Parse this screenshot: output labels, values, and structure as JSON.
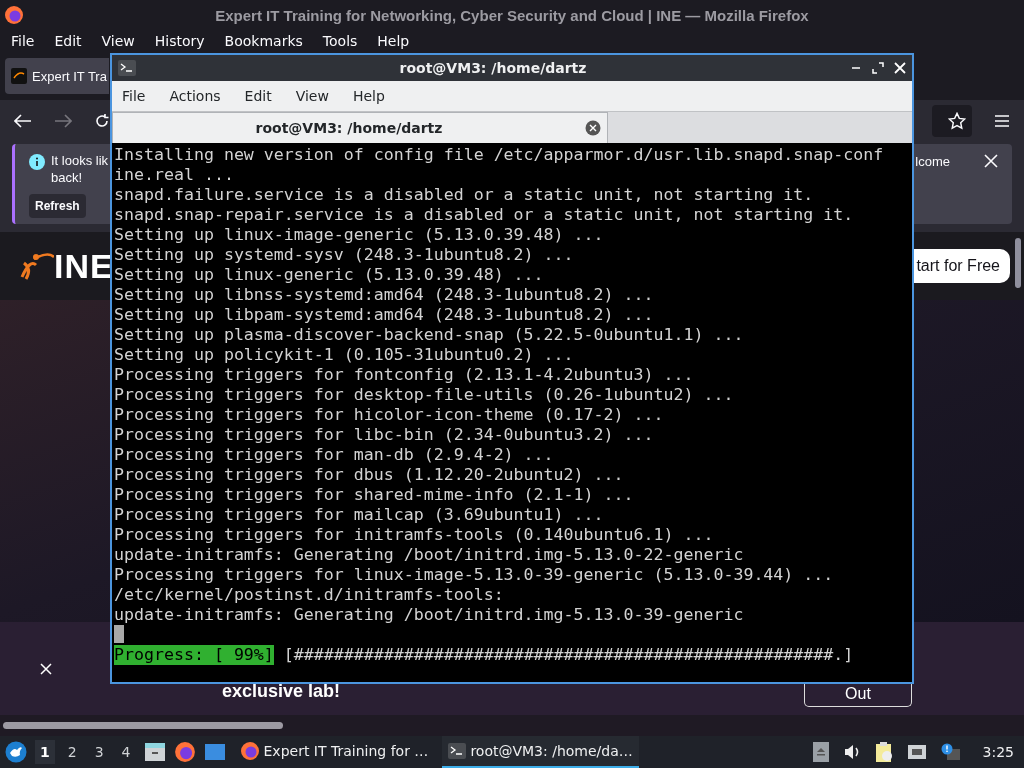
{
  "firefox": {
    "title": "Expert IT Training for Networking, Cyber Security and Cloud | INE — Mozilla Firefox",
    "menu": [
      "File",
      "Edit",
      "View",
      "History",
      "Bookmarks",
      "Tools",
      "Help"
    ],
    "tab": {
      "title": "Expert IT Tra"
    },
    "notification": {
      "lines": [
        "It looks lik",
        "back!"
      ],
      "button": "Refresh",
      "right_text": "lcome"
    },
    "site": {
      "logo": "INE",
      "cta": "tart for Free"
    },
    "banner": {
      "text": "exclusive lab!",
      "button": "Out"
    }
  },
  "terminal": {
    "title": "root@VM3: /home/dartz",
    "menu": [
      "File",
      "Actions",
      "Edit",
      "View",
      "Help"
    ],
    "tab": {
      "title": "root@VM3: /home/dartz"
    },
    "lines": [
      "Installing new version of config file /etc/apparmor.d/usr.lib.snapd.snap-conf",
      "ine.real ...",
      "snapd.failure.service is a disabled or a static unit, not starting it.",
      "snapd.snap-repair.service is a disabled or a static unit, not starting it.",
      "Setting up linux-image-generic (5.13.0.39.48) ...",
      "Setting up systemd-sysv (248.3-1ubuntu8.2) ...",
      "Setting up linux-generic (5.13.0.39.48) ...",
      "Setting up libnss-systemd:amd64 (248.3-1ubuntu8.2) ...",
      "Setting up libpam-systemd:amd64 (248.3-1ubuntu8.2) ...",
      "Setting up plasma-discover-backend-snap (5.22.5-0ubuntu1.1) ...",
      "Setting up policykit-1 (0.105-31ubuntu0.2) ...",
      "Processing triggers for fontconfig (2.13.1-4.2ubuntu3) ...",
      "Processing triggers for desktop-file-utils (0.26-1ubuntu2) ...",
      "Processing triggers for hicolor-icon-theme (0.17-2) ...",
      "Processing triggers for libc-bin (2.34-0ubuntu3.2) ...",
      "Processing triggers for man-db (2.9.4-2) ...",
      "Processing triggers for dbus (1.12.20-2ubuntu2) ...",
      "Processing triggers for shared-mime-info (2.1-1) ...",
      "Processing triggers for mailcap (3.69ubuntu1) ...",
      "Processing triggers for initramfs-tools (0.140ubuntu6.1) ...",
      "update-initramfs: Generating /boot/initrd.img-5.13.0-22-generic",
      "Processing triggers for linux-image-5.13.0-39-generic (5.13.0-39.44) ...",
      "/etc/kernel/postinst.d/initramfs-tools:",
      "update-initramfs: Generating /boot/initrd.img-5.13.0-39-generic"
    ],
    "progress": {
      "label": "Progress: [ 99%]",
      "bar": "[######################################################.]"
    }
  },
  "taskbar": {
    "desktops": [
      {
        "label": "1",
        "selected": true
      },
      {
        "label": "2",
        "selected": false
      },
      {
        "label": "3",
        "selected": false
      },
      {
        "label": "4",
        "selected": false
      }
    ],
    "tasks": [
      {
        "label": "Expert IT Training for …",
        "kind": "firefox",
        "active": false
      },
      {
        "label": "root@VM3: /home/da…",
        "kind": "terminal",
        "active": true
      }
    ],
    "clock": "3:25"
  }
}
